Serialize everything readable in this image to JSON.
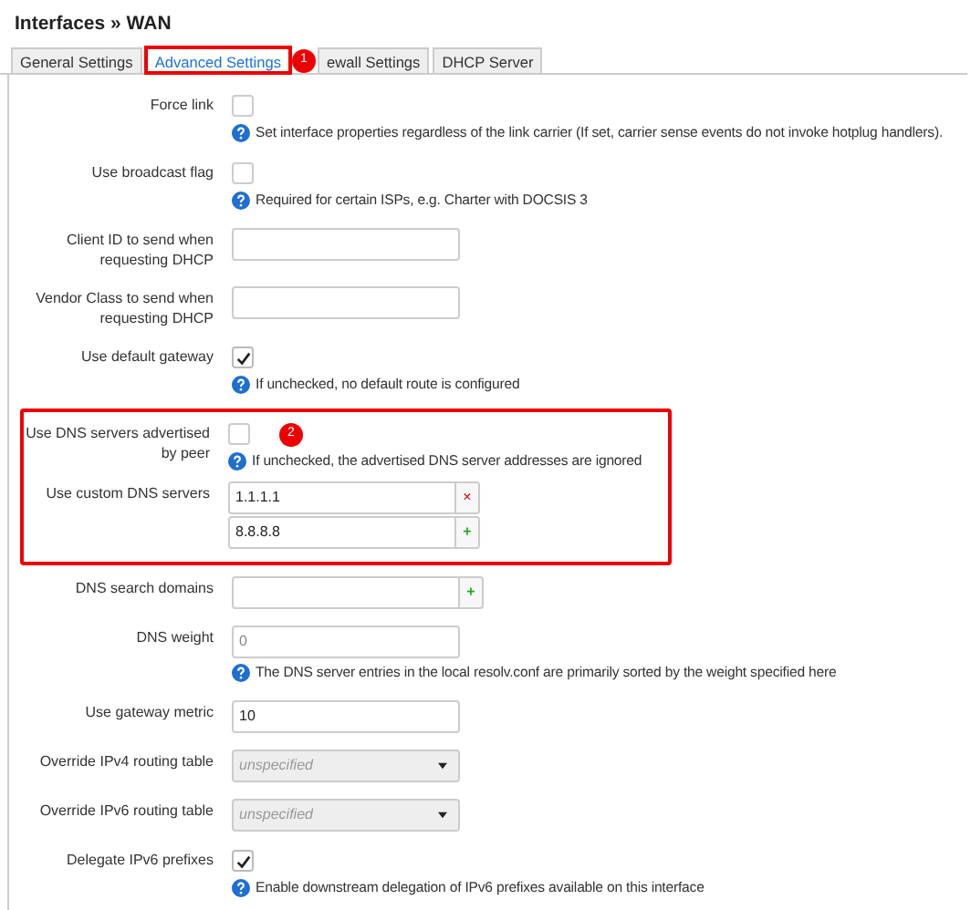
{
  "title": "Interfaces » WAN",
  "tabs": [
    {
      "label": "General Settings",
      "selected": false,
      "highlight": false
    },
    {
      "label": "Advanced Settings",
      "selected": true,
      "highlight": true,
      "badge": "1"
    },
    {
      "label": "ewall Settings",
      "selected": false,
      "highlight": false
    },
    {
      "label": "DHCP Server",
      "selected": false,
      "highlight": false
    }
  ],
  "sections": [
    {
      "highlight": false,
      "rows": [
        {
          "kind": "checkbox",
          "label": "Force link",
          "checked": false,
          "help": "Set interface properties regardless of the link carrier (If set, carrier sense events do not invoke hotplug handlers)."
        },
        {
          "kind": "checkbox",
          "label": "Use broadcast flag",
          "checked": false,
          "help": "Required for certain ISPs, e.g. Charter with DOCSIS 3"
        },
        {
          "kind": "text",
          "label": "Client ID to send when requesting DHCP"
        },
        {
          "kind": "text",
          "label": "Vendor Class to send when requesting DHCP"
        },
        {
          "kind": "checkbox",
          "label": "Use default gateway",
          "checked": true,
          "help": "If unchecked, no default route is configured"
        }
      ]
    },
    {
      "highlight": true,
      "rows": [
        {
          "kind": "checkbox",
          "label": "Use DNS servers advertised by peer",
          "checked": false,
          "badge": "2",
          "help": "If unchecked, the advertised DNS server addresses are ignored"
        },
        {
          "kind": "dynlist",
          "label": "Use custom DNS servers",
          "items": [
            {
              "value": "1.1.1.1",
              "action": "×",
              "kind": "remove"
            },
            {
              "value": "8.8.8.8",
              "action": "+",
              "kind": "add"
            }
          ]
        }
      ]
    },
    {
      "highlight": false,
      "rows": [
        {
          "kind": "dynlist",
          "label": "DNS search domains",
          "items": [
            {
              "action": "+",
              "kind": "add"
            }
          ]
        },
        {
          "kind": "text",
          "label": "DNS weight",
          "placeholder": "0",
          "help": "The DNS server entries in the local resolv.conf are primarily sorted by the weight specified here"
        },
        {
          "kind": "text",
          "label": "Use gateway metric",
          "value": "10"
        },
        {
          "kind": "select",
          "label": "Override IPv4 routing table",
          "value": "unspecified"
        },
        {
          "kind": "select",
          "label": "Override IPv6 routing table",
          "value": "unspecified"
        },
        {
          "kind": "checkbox",
          "label": "Delegate IPv6 prefixes",
          "checked": true,
          "help": "Enable downstream delegation of IPv6 prefixes available on this interface"
        }
      ]
    }
  ]
}
